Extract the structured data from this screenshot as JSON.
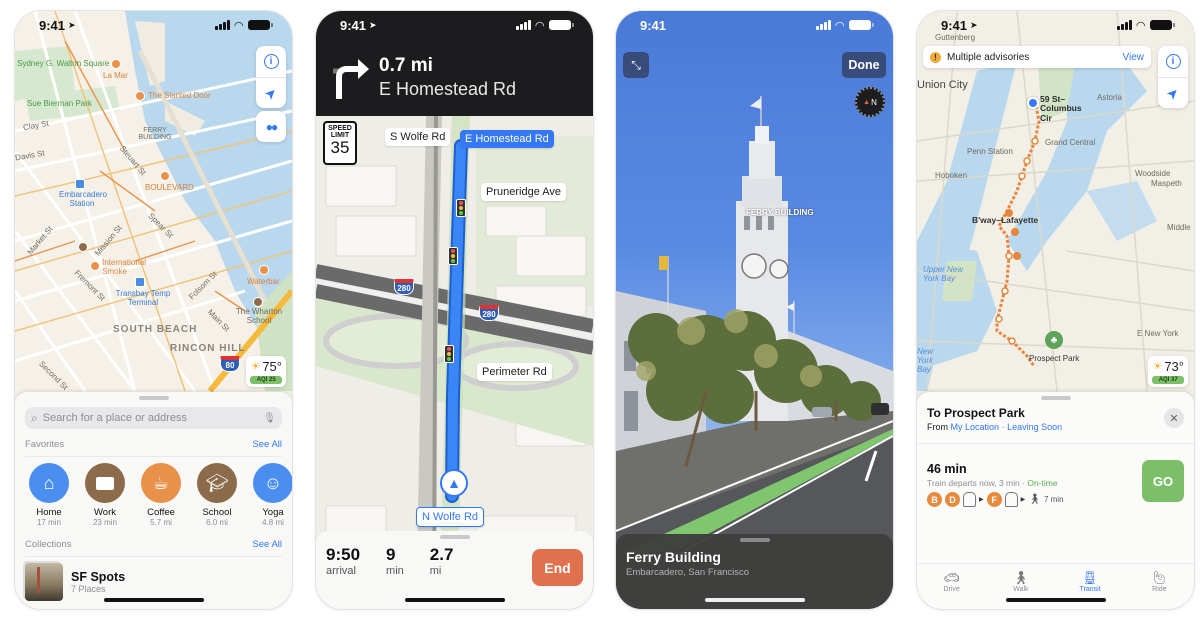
{
  "phones": {
    "explore": {
      "status": {
        "time": "9:41"
      },
      "map": {
        "labels": [
          "Sydney G. Walton Square",
          "Sue Bierman Park",
          "Clay St",
          "Davis St",
          "La Mar",
          "The Slanted Door",
          "FERRY BUILDING",
          "Steuart St",
          "BOULEVARD",
          "Embarcadero Station",
          "Market St",
          "Mission St",
          "Fremont St",
          "International Smoke",
          "Transbay Temp Terminal",
          "Spear St",
          "Folsom St",
          "Main St",
          "Waterbar",
          "The Wharton School",
          "SOUTH BEACH",
          "RINCON HILL",
          "Second St"
        ],
        "highway": "80"
      },
      "controls": [
        "info-icon",
        "location-arrow-icon",
        "binoculars-icon"
      ],
      "weather": {
        "temp": "75°",
        "aqi": "AQI 25"
      },
      "search": {
        "placeholder": "Search for a place or address"
      },
      "favorites": {
        "title": "Favorites",
        "see_all": "See All",
        "items": [
          {
            "label": "Home",
            "sub": "17 min",
            "icon": "home-icon",
            "color": "#4a8ff0"
          },
          {
            "label": "Work",
            "sub": "23 min",
            "icon": "briefcase-icon",
            "color": "#8c6b4a"
          },
          {
            "label": "Coffee",
            "sub": "5.7 mi",
            "icon": "coffee-icon",
            "color": "#e8914a"
          },
          {
            "label": "School",
            "sub": "6.0 mi",
            "icon": "graduation-cap-icon",
            "color": "#8c6b4a"
          },
          {
            "label": "Yoga",
            "sub": "4.8 mi",
            "icon": "meditation-icon",
            "color": "#4a8ff0"
          }
        ]
      },
      "collections": {
        "title": "Collections",
        "see_all": "See All",
        "items": [
          {
            "title": "SF Spots",
            "sub": "7 Places"
          }
        ]
      }
    },
    "navigation": {
      "status": {
        "time": "9:41"
      },
      "maneuver": {
        "distance": "0.7 mi",
        "street": "E Homestead Rd",
        "icon": "turn-right-icon"
      },
      "speed_limit": {
        "title": "SPEED LIMIT",
        "value": "35"
      },
      "streets": {
        "s_wolfe": "S Wolfe Rd",
        "e_homestead": "E Homestead Rd",
        "pruneridge": "Pruneridge Ave",
        "perimeter": "Perimeter Rd",
        "current": "N Wolfe Rd"
      },
      "highway": "280",
      "trip": {
        "arrival": {
          "value": "9:50",
          "label": "arrival"
        },
        "duration": {
          "value": "9",
          "label": "min"
        },
        "distance": {
          "value": "2.7",
          "label": "mi"
        },
        "end_label": "End",
        "end_color": "#df714e"
      }
    },
    "look_around": {
      "status": {
        "time": "9:41"
      },
      "done_label": "Done",
      "landmark_label": "FERRY BUILDING",
      "place": {
        "title": "Ferry Building",
        "subtitle": "Embarcadero, San Francisco"
      }
    },
    "transit": {
      "status": {
        "time": "9:41"
      },
      "advisory": {
        "text": "Multiple advisories",
        "action": "View"
      },
      "map": {
        "labels": [
          "Guttenberg",
          "Union City",
          "Astoria",
          "Grand Central",
          "Penn Station",
          "Hoboken",
          "Woodside",
          "Maspeth",
          "B'way–Lafayette",
          "Middle",
          "Upper New York Bay",
          "E New York",
          "New York Bay",
          "Prospect Park"
        ],
        "origin": "59 St–Columbus Cir"
      },
      "weather": {
        "temp": "73°",
        "aqi": "AQI 37"
      },
      "directions": {
        "title": "To Prospect Park",
        "from_prefix": "From",
        "from_location": "My Location",
        "separator": "·",
        "when": "Leaving Soon",
        "route": {
          "duration": "46 min",
          "info": "Train departs now, 3 min ·",
          "status": "On-time",
          "lines": [
            "B",
            "D",
            "F"
          ],
          "walk": "7 min"
        },
        "go_label": "GO",
        "go_color": "#7cbf6a",
        "modes": [
          {
            "label": "Drive",
            "active": false
          },
          {
            "label": "Walk",
            "active": false
          },
          {
            "label": "Transit",
            "active": true
          },
          {
            "label": "Ride",
            "active": false
          }
        ]
      }
    }
  }
}
